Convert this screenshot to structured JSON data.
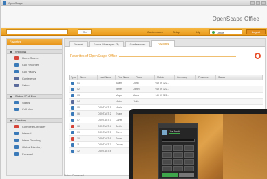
{
  "window": {
    "title": "OpenScape"
  },
  "brand": {
    "name": "OpenScape Office"
  },
  "toolbar": {
    "search_placeholder": "",
    "go_label": "Go",
    "links": [
      "Conferences",
      "Setup",
      "Help"
    ],
    "presence": "Office",
    "logout_label": "Logout"
  },
  "sidebar": {
    "header": "Favorites",
    "sections": [
      {
        "label": "Windows",
        "items": [
          "Home Screen",
          "Call Recorder",
          "Call History",
          "Conference",
          "Setup"
        ]
      },
      {
        "label": "Status / Call Now",
        "items": [
          "Status",
          "Call Now"
        ]
      },
      {
        "label": "Directory",
        "items": [
          "Complete Directory",
          "Internal",
          "Intern Directory",
          "Global Directory",
          "Personal"
        ]
      }
    ]
  },
  "tabs": [
    "Journal",
    "Voice Messages (3)",
    "Conferences",
    "Favorites"
  ],
  "panel": {
    "title": "Favorites of OpenScape Office"
  },
  "table": {
    "columns": [
      "Type",
      "Name",
      "Last Name",
      "First Name",
      "Phone",
      "Mobile",
      "Company",
      "Presence",
      "Status"
    ],
    "rows": [
      [
        "01",
        "",
        "Adam",
        "John",
        "+49 89 722...",
        "",
        "",
        "",
        ""
      ],
      [
        "02",
        "",
        "James",
        "Janet",
        "+49 89 722...",
        "",
        "",
        "",
        ""
      ],
      [
        "03",
        "",
        "Mayer",
        "Anna",
        "+49 89 722...",
        "",
        "",
        "",
        ""
      ],
      [
        "04",
        "",
        "Maier",
        "Jutta",
        "",
        "",
        "",
        "",
        ""
      ],
      [
        "05",
        "CONTACT 1",
        "Martin",
        "",
        "",
        "",
        "",
        "",
        ""
      ],
      [
        "06",
        "CONTACT 2",
        "Evans",
        "",
        "",
        "",
        "",
        "",
        ""
      ],
      [
        "07",
        "CONTACT 3",
        "Carter",
        "",
        "",
        "",
        "",
        "",
        ""
      ],
      [
        "08",
        "CONTACT 4",
        "Smith",
        "",
        "",
        "",
        "",
        "",
        ""
      ],
      [
        "09",
        "CONTACT 5",
        "Green",
        "",
        "",
        "",
        "",
        "",
        ""
      ],
      [
        "10",
        "CONTACT 6",
        "Tower",
        "",
        "",
        "",
        "",
        "",
        ""
      ],
      [
        "11",
        "CONTACT 7",
        "Dooley",
        "",
        "",
        "",
        "",
        "",
        ""
      ],
      [
        "12",
        "CONTACT 8",
        "",
        "",
        "",
        "",
        "",
        "",
        ""
      ]
    ]
  },
  "statusbar": {
    "text": "Status: Connected"
  },
  "laptop_client": {
    "user_name": "Joe Smith"
  },
  "colors": {
    "accent": "#e99a1c",
    "presence_available": "#3fa54a",
    "help": "#e8502c"
  }
}
